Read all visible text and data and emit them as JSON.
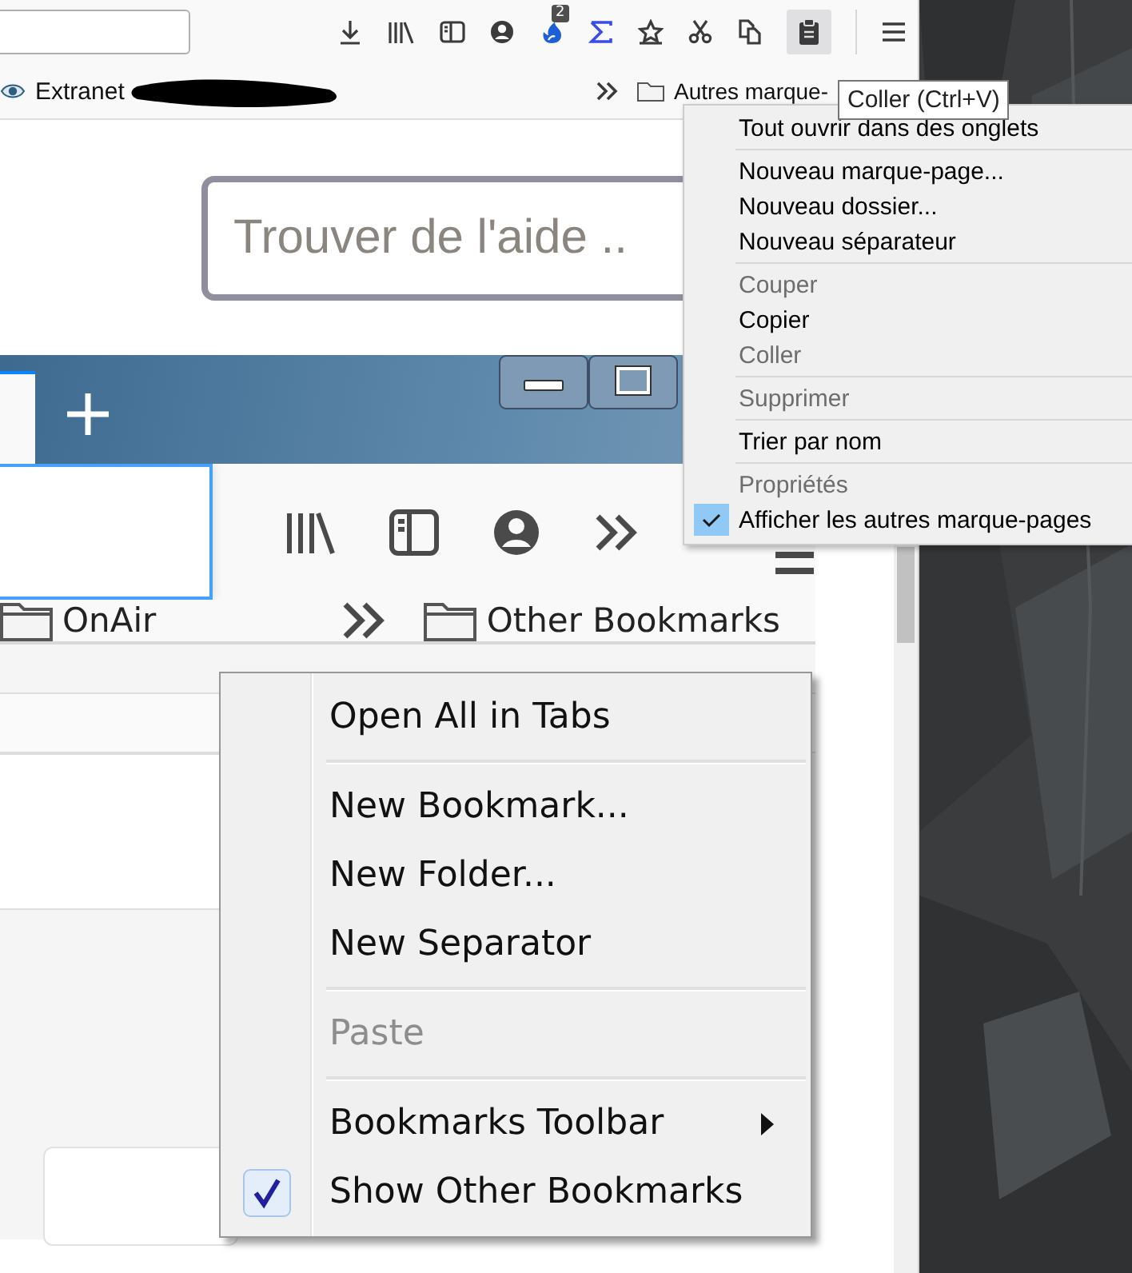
{
  "toolbar": {
    "extension_badge": "2",
    "paste_button": {
      "hovered": true
    }
  },
  "bookmarks_bar": {
    "items": [
      {
        "label": "Extranet",
        "redacted": true
      }
    ],
    "other_bookmarks": "Autres marque-"
  },
  "search": {
    "placeholder": "Trouver de l'aide .."
  },
  "tooltip": "Coller (Ctrl+V)",
  "context_menu": {
    "items": [
      {
        "kind": "item",
        "label": "Tout ouvrir dans des onglets",
        "disabled": false,
        "checked": false
      },
      {
        "kind": "separator"
      },
      {
        "kind": "item",
        "label": "Nouveau marque-page...",
        "disabled": false,
        "checked": false
      },
      {
        "kind": "item",
        "label": "Nouveau dossier...",
        "disabled": false,
        "checked": false
      },
      {
        "kind": "item",
        "label": "Nouveau séparateur",
        "disabled": false,
        "checked": false
      },
      {
        "kind": "separator"
      },
      {
        "kind": "item",
        "label": "Couper",
        "disabled": true,
        "checked": false
      },
      {
        "kind": "item",
        "label": "Copier",
        "disabled": false,
        "checked": false
      },
      {
        "kind": "item",
        "label": "Coller",
        "disabled": true,
        "checked": false
      },
      {
        "kind": "separator"
      },
      {
        "kind": "item",
        "label": "Supprimer",
        "disabled": true,
        "checked": false
      },
      {
        "kind": "separator"
      },
      {
        "kind": "item",
        "label": "Trier par nom",
        "disabled": false,
        "checked": false
      },
      {
        "kind": "separator"
      },
      {
        "kind": "item",
        "label": "Propriétés",
        "disabled": true,
        "checked": false
      },
      {
        "kind": "item",
        "label": "Afficher les autres marque-pages",
        "disabled": false,
        "checked": true
      }
    ]
  },
  "screenshot": {
    "bookmarks": [
      {
        "label": "OnAir"
      }
    ],
    "other_bookmarks": "Other Bookmarks",
    "context_menu": {
      "items": [
        {
          "kind": "item",
          "label": "Open All in Tabs",
          "disabled": false,
          "checked": false,
          "submenu": false
        },
        {
          "kind": "separator"
        },
        {
          "kind": "item",
          "label": "New Bookmark...",
          "disabled": false,
          "checked": false,
          "submenu": false
        },
        {
          "kind": "item",
          "label": "New Folder...",
          "disabled": false,
          "checked": false,
          "submenu": false
        },
        {
          "kind": "item",
          "label": "New Separator",
          "disabled": false,
          "checked": false,
          "submenu": false
        },
        {
          "kind": "separator"
        },
        {
          "kind": "item",
          "label": "Paste",
          "disabled": true,
          "checked": false,
          "submenu": false
        },
        {
          "kind": "separator"
        },
        {
          "kind": "item",
          "label": "Bookmarks Toolbar",
          "disabled": false,
          "checked": false,
          "submenu": true
        },
        {
          "kind": "item",
          "label": "Show Other Bookmarks",
          "disabled": false,
          "checked": true,
          "submenu": false
        }
      ]
    }
  }
}
